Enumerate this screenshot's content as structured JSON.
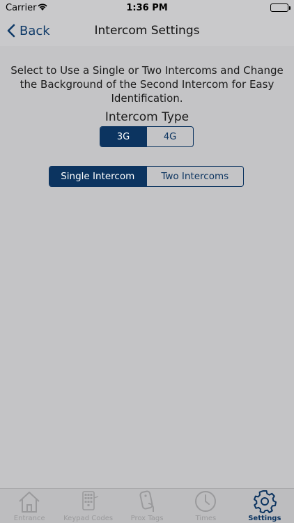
{
  "status_bar": {
    "carrier": "Carrier",
    "time": "1:36 PM"
  },
  "nav": {
    "back_label": "Back",
    "title": "Intercom Settings"
  },
  "main": {
    "instructions": "Select to Use a Single or Two Intercoms and Change the Background of the Second Intercom for Easy Identification.",
    "intercom_type_label": "Intercom Type",
    "intercom_type_options": [
      "3G",
      "4G"
    ],
    "intercom_type_selected": "3G",
    "intercom_count_options": [
      "Single Intercom",
      "Two Intercoms"
    ],
    "intercom_count_selected": "Single Intercom"
  },
  "tab_bar": {
    "items": [
      {
        "label": "Entrance",
        "icon": "house-icon"
      },
      {
        "label": "Keypad Codes",
        "icon": "keypad-icon"
      },
      {
        "label": "Prox Tags",
        "icon": "prox-tag-icon"
      },
      {
        "label": "Times",
        "icon": "clock-icon"
      },
      {
        "label": "Settings",
        "icon": "gear-icon"
      }
    ],
    "active": "Settings"
  },
  "colors": {
    "accent": "#0c3460",
    "background": "#c4c4c6",
    "inactive_tab": "#9a9a9c"
  }
}
